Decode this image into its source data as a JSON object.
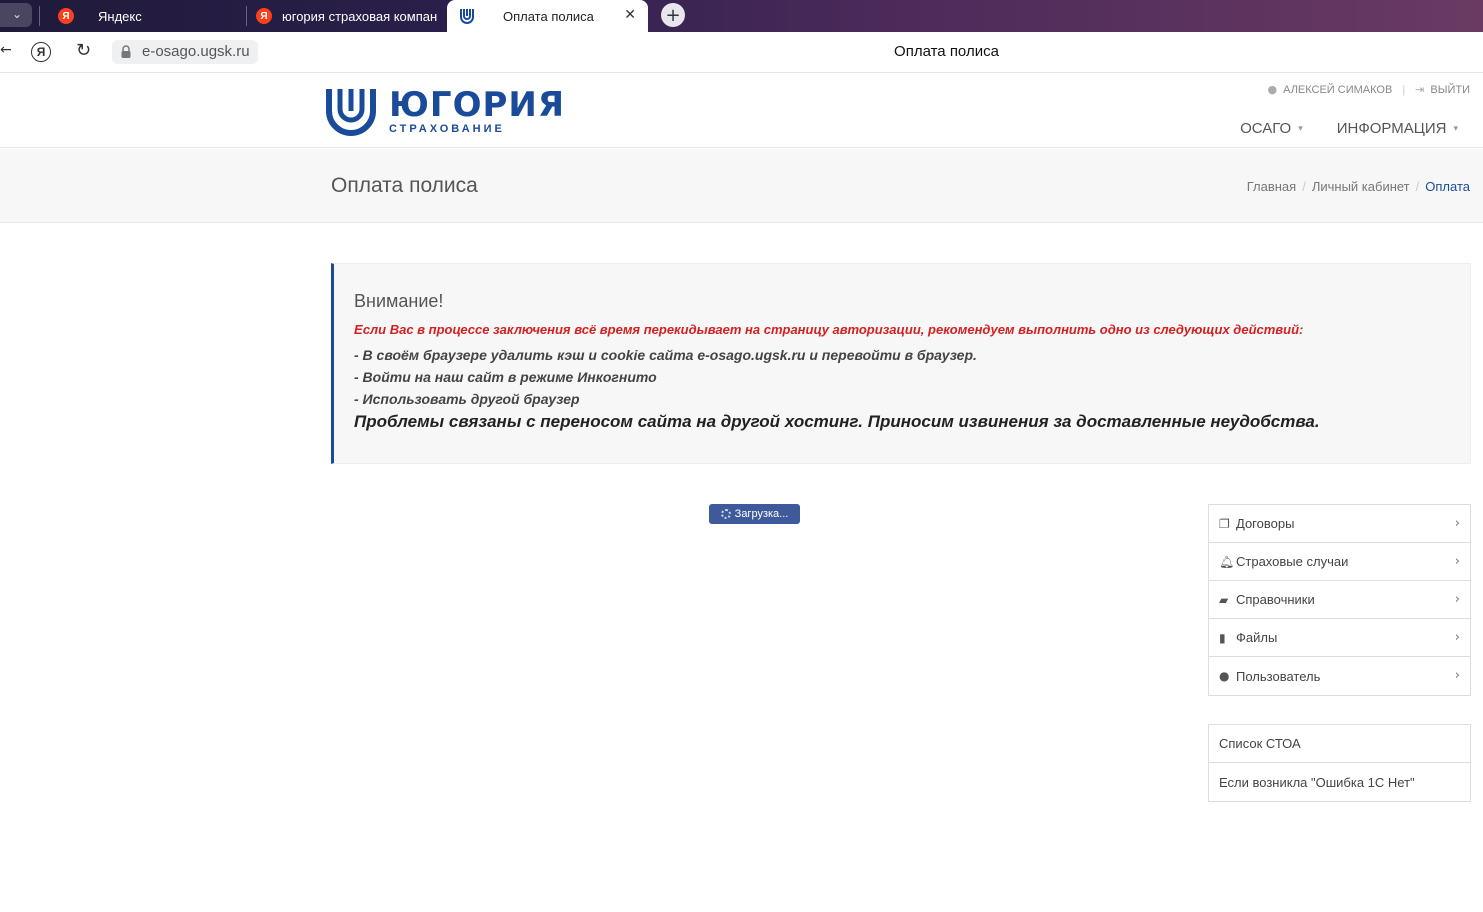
{
  "browser": {
    "tabs": [
      {
        "label": "Яндекс",
        "favicon": "yandex-icon",
        "active": false
      },
      {
        "label": "югория страховая компания",
        "favicon": "yandex-icon",
        "active": false
      },
      {
        "label": "Оплата полиса",
        "favicon": "ugoria-icon",
        "active": true
      }
    ],
    "new_tab_symbol": "+",
    "close_symbol": "✕",
    "url": "e-osago.ugsk.ru",
    "page_title": "Оплата полиса",
    "yandex_letter": "Я",
    "yandex_favicon_letter": "Я"
  },
  "header": {
    "brand": "ЮГОРИЯ",
    "brand_sub": "СТРАХОВАНИЕ",
    "user_name": "АЛЕКСЕЙ СИМАКОВ",
    "logout_label": "ВЫЙТИ",
    "nav": [
      {
        "label": "ОСАГО"
      },
      {
        "label": "ИНФОРМАЦИЯ"
      }
    ],
    "brand_color": "#1a4b9b"
  },
  "page": {
    "title": "Оплата полиса",
    "breadcrumbs": [
      "Главная",
      "Личный кабинет",
      "Оплата"
    ]
  },
  "notice": {
    "heading": "Внимание!",
    "warning": "Если Вас в процессе заключения всё время перекидывает на страницу авторизации, рекомендуем выполнить одно из следующих действий:",
    "steps": [
      "- В своём браузере удалить кэш и cookie сайта e-osago.ugsk.ru и перевойти в браузер.",
      "- Войти на наш сайт в режиме Инкогнито",
      "- Использовать другой браузер"
    ],
    "apology": "Проблемы связаны с переносом сайта на другой хостинг. Приносим извинения за доставленные неудобства.",
    "warning_color": "#d42020"
  },
  "loading_label": "Загрузка...",
  "sidebar": {
    "menu": [
      {
        "label": "Договоры",
        "icon": "copy-icon"
      },
      {
        "label": "Страховые случаи",
        "icon": "bell-icon"
      },
      {
        "label": "Справочники",
        "icon": "folder-open-icon"
      },
      {
        "label": "Файлы",
        "icon": "file-icon"
      },
      {
        "label": "Пользователь",
        "icon": "user-icon"
      }
    ],
    "links": [
      {
        "label": "Список СТОА"
      },
      {
        "label": "Если возникла \"Ошибка 1С Нет\""
      }
    ]
  }
}
